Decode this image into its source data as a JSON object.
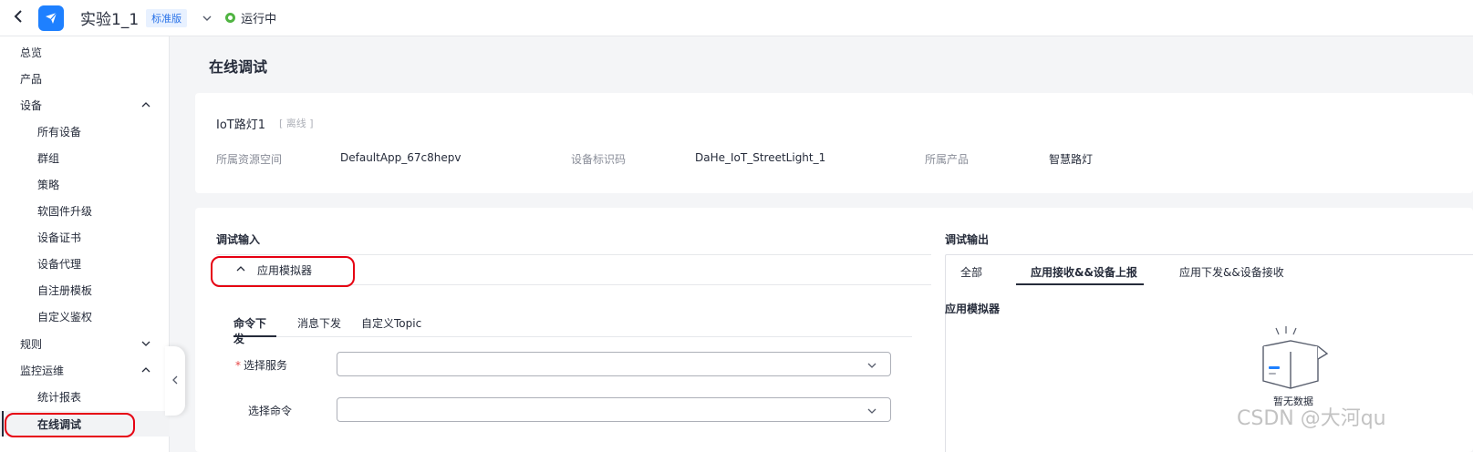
{
  "header": {
    "app_title": "实验1_1",
    "edition_badge": "标准版",
    "status": "运行中"
  },
  "sidebar": {
    "items": [
      {
        "label": "总览"
      },
      {
        "label": "产品"
      },
      {
        "label": "设备"
      },
      {
        "label": "所有设备"
      },
      {
        "label": "群组"
      },
      {
        "label": "策略"
      },
      {
        "label": "软固件升级"
      },
      {
        "label": "设备证书"
      },
      {
        "label": "设备代理"
      },
      {
        "label": "自注册模板"
      },
      {
        "label": "自定义鉴权"
      },
      {
        "label": "规则"
      },
      {
        "label": "监控运维"
      },
      {
        "label": "统计报表"
      },
      {
        "label": "在线调试"
      }
    ]
  },
  "page": {
    "title": "在线调试"
  },
  "device": {
    "name": "IoT路灯1",
    "status": "[ 离线 ]",
    "meta": [
      {
        "label": "所属资源空间",
        "value": "DefaultApp_67c8hepv"
      },
      {
        "label": "设备标识码",
        "value": "DaHe_IoT_StreetLight_1"
      },
      {
        "label": "所属产品",
        "value": "智慧路灯"
      }
    ]
  },
  "debug_input": {
    "title": "调试输入",
    "simulator_label": "应用模拟器",
    "tabs": [
      "命令下发",
      "消息下发",
      "自定义Topic"
    ],
    "fields": [
      {
        "label": "选择服务",
        "required": true,
        "value": ""
      },
      {
        "label": "选择命令",
        "required": false,
        "value": ""
      }
    ]
  },
  "debug_output": {
    "title": "调试输出",
    "tabs": [
      "全部",
      "应用接收&&设备上报",
      "应用下发&&设备接收"
    ],
    "section_label": "应用模拟器",
    "empty_text": "暂无数据"
  },
  "watermark": "CSDN @大河qu",
  "colors": {
    "accent_blue": "#1e80ff",
    "status_green": "#50b442",
    "annotation_red": "#e60012",
    "required_red": "#e54545"
  }
}
